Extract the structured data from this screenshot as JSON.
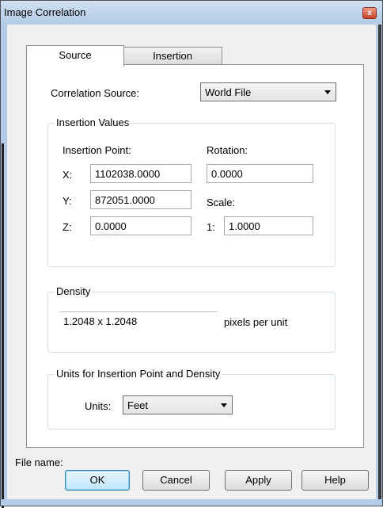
{
  "window": {
    "title": "Image Correlation",
    "close_glyph": "x"
  },
  "tabs": [
    {
      "label": "Source",
      "active": true
    },
    {
      "label": "Insertion",
      "active": false
    }
  ],
  "source": {
    "correlation_label": "Correlation Source:",
    "correlation_value": "World File",
    "insertion_group": {
      "legend": "Insertion Values",
      "point_label": "Insertion Point:",
      "x_label": "X:",
      "x_value": "1102038.0000",
      "y_label": "Y:",
      "y_value": "872051.0000",
      "z_label": "Z:",
      "z_value": "0.0000",
      "rotation_label": "Rotation:",
      "rotation_value": "0.0000",
      "scale_label": "Scale:",
      "scale_prefix": "1:",
      "scale_value": "1.0000"
    },
    "density_group": {
      "legend": "Density",
      "value": "1.2048 x 1.2048",
      "unit": "pixels per unit"
    },
    "units_group": {
      "legend": "Units for Insertion Point and Density",
      "units_label": "Units:",
      "units_value": "Feet"
    }
  },
  "file_name_label": "File name:",
  "buttons": {
    "ok": "OK",
    "cancel": "Cancel",
    "apply": "Apply",
    "help": "Help"
  },
  "colors": {
    "titlebar": "#b3cbe6",
    "close": "#c5432a",
    "ok_border": "#3c7fb1"
  }
}
